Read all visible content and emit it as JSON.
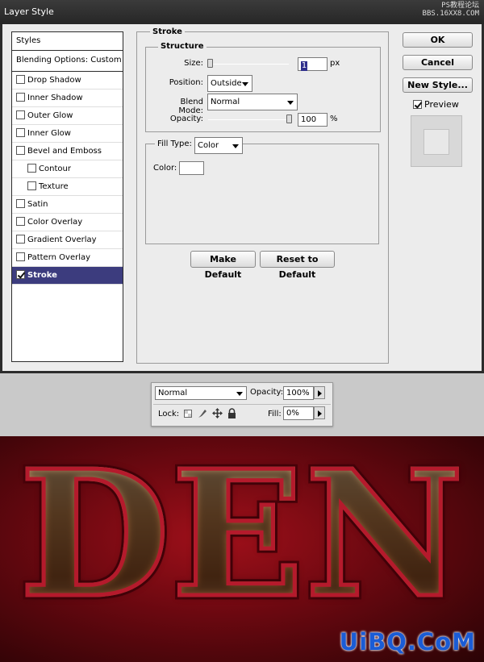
{
  "dialog": {
    "title": "Layer Style",
    "watermark_top_line1": "PS教程论坛",
    "watermark_top_line2": "BBS.16XX8.COM"
  },
  "styles": {
    "header": "Styles",
    "blending_options": "Blending Options: Custom",
    "items": [
      {
        "label": "Drop Shadow",
        "checked": false,
        "sub": false
      },
      {
        "label": "Inner Shadow",
        "checked": false,
        "sub": false
      },
      {
        "label": "Outer Glow",
        "checked": false,
        "sub": false
      },
      {
        "label": "Inner Glow",
        "checked": false,
        "sub": false
      },
      {
        "label": "Bevel and Emboss",
        "checked": false,
        "sub": false
      },
      {
        "label": "Contour",
        "checked": false,
        "sub": true
      },
      {
        "label": "Texture",
        "checked": false,
        "sub": true
      },
      {
        "label": "Satin",
        "checked": false,
        "sub": false
      },
      {
        "label": "Color Overlay",
        "checked": false,
        "sub": false
      },
      {
        "label": "Gradient Overlay",
        "checked": false,
        "sub": false
      },
      {
        "label": "Pattern Overlay",
        "checked": false,
        "sub": false
      },
      {
        "label": "Stroke",
        "checked": true,
        "sub": false,
        "active": true
      }
    ]
  },
  "stroke": {
    "title": "Stroke",
    "structure_title": "Structure",
    "size_label": "Size:",
    "size_value": "1",
    "size_unit": "px",
    "position_label": "Position:",
    "position_value": "Outside",
    "blend_mode_label": "Blend Mode:",
    "blend_mode_value": "Normal",
    "opacity_label": "Opacity:",
    "opacity_value": "100",
    "opacity_unit": "%",
    "fill_type_label": "Fill Type:",
    "fill_type_value": "Color",
    "color_label": "Color:",
    "color_value": "#ffffff",
    "make_default": "Make Default",
    "reset_default": "Reset to Default"
  },
  "buttons": {
    "ok": "OK",
    "cancel": "Cancel",
    "new_style": "New Style...",
    "preview": "Preview",
    "preview_checked": true
  },
  "layers": {
    "blend_mode": "Normal",
    "opacity_label": "Opacity:",
    "opacity_value": "100%",
    "lock_label": "Lock:",
    "fill_label": "Fill:",
    "fill_value": "0%"
  },
  "artwork": {
    "text": "DEN",
    "watermark": "UiBQ.CoM"
  }
}
